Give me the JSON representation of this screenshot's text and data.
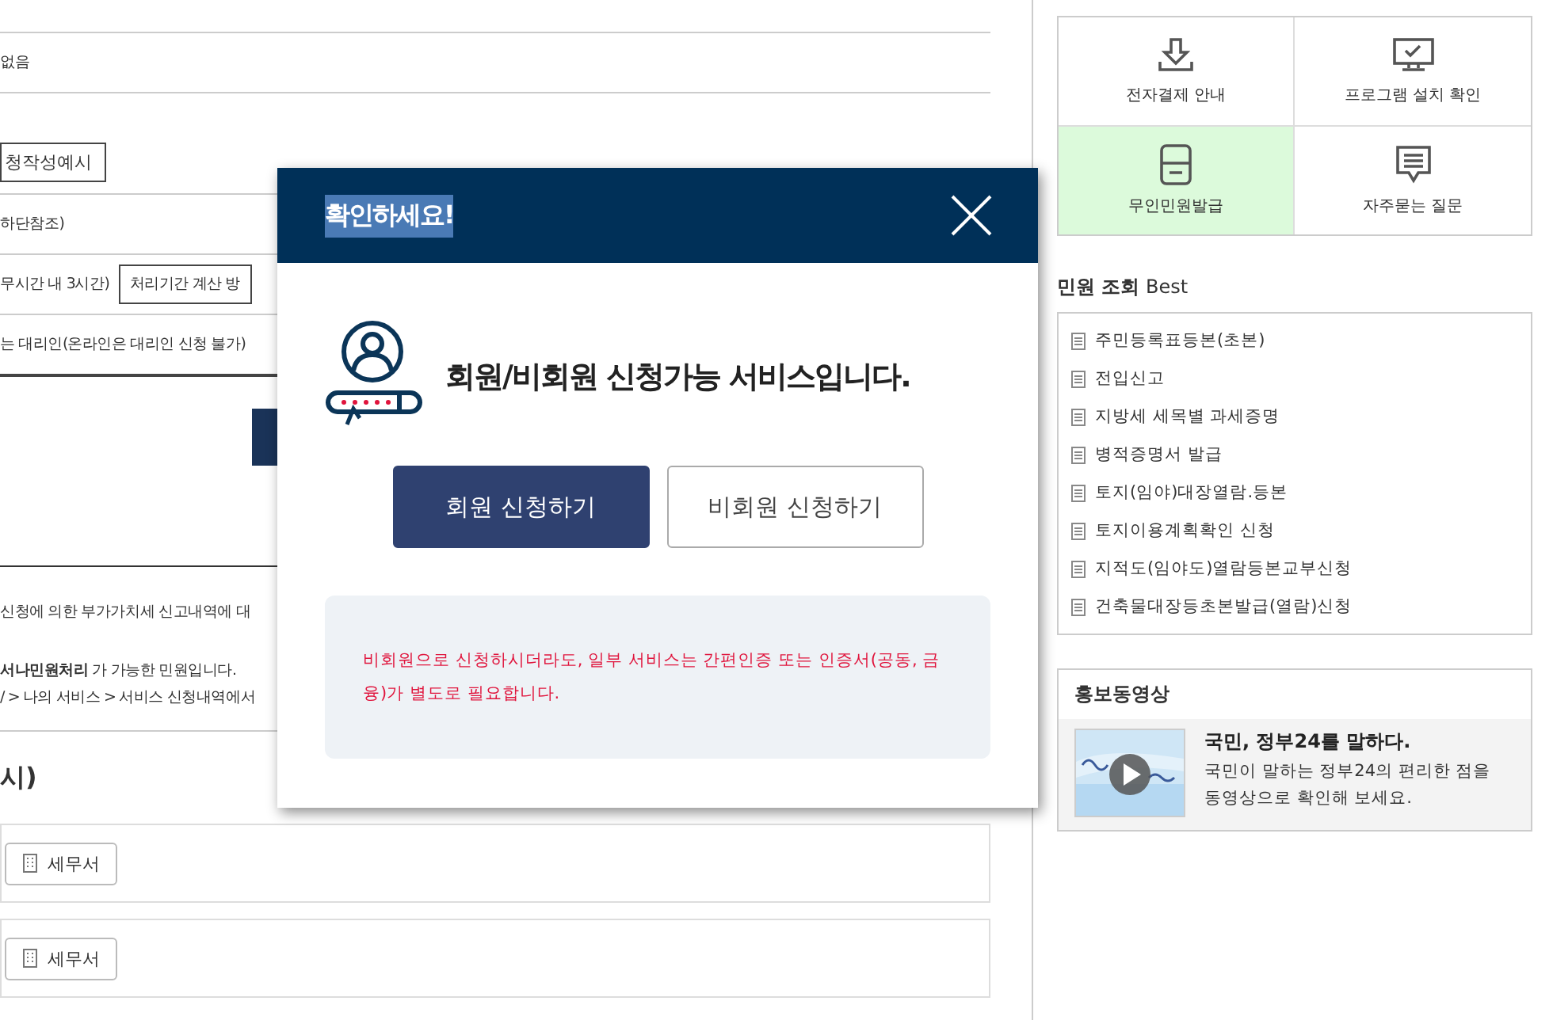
{
  "content": {
    "rows": [
      {
        "kind": "text",
        "text": "없음"
      },
      {
        "kind": "box",
        "text": "청작성예시"
      },
      {
        "kind": "text",
        "text": "하단참조)"
      },
      {
        "kind": "text_button",
        "text": "무시간 내 3시간)",
        "button": "처리기간 계산 방"
      },
      {
        "kind": "text",
        "text": "는 대리인(온라인은 대리인 신청 불가)"
      }
    ],
    "notes": [
      "신청에 의한 부가가치세 신고내역에 대",
      "**서나민원처리** 가 가능한 민원입니다.",
      "/ > 나의 서비스 > 서비스 신청내역에서"
    ],
    "section_title": "시)",
    "offices": [
      {
        "label": "세무서"
      },
      {
        "label": "세무서"
      }
    ]
  },
  "quick_menu": [
    {
      "label": "전자결제 안내",
      "kind": "download",
      "selected": false
    },
    {
      "label": "프로그램 설치 확인",
      "kind": "monitor",
      "selected": false
    },
    {
      "label": "무인민원발급",
      "kind": "kiosk",
      "selected": true
    },
    {
      "label": "자주묻는 질문",
      "kind": "chat",
      "selected": false
    }
  ],
  "best": {
    "title": "**민원 조회** Best",
    "items": [
      "주민등록표등본(초본)",
      "전입신고",
      "지방세 세목별 과세증명",
      "병적증명서 발급",
      "토지(임야)대장열람.등본",
      "토지이용계획확인 신청",
      "지적도(임야도)열람등본교부신청",
      "건축물대장등초본발급(열람)신청"
    ]
  },
  "video": {
    "title": "홍보동영상",
    "headline": "국민, 정부24를 말하다.",
    "lines": [
      "국민이 말하는 정부24의 편리한 점을",
      "동영상으로 확인해 보세요."
    ]
  },
  "dialog": {
    "title": "확인하세요!",
    "title_selected": true,
    "message": "회원/비회원 신청가능 서비스입니다.",
    "buttons": [
      {
        "label": "회원 신청하기",
        "kind": "primary"
      },
      {
        "label": "비회원 신청하기",
        "kind": "secondary"
      }
    ],
    "notice": "비회원으로 신청하시더라도, 일부 서비스는 간편인증 또는 인증서(공동, 금융)가 별도로 필요합니다."
  }
}
